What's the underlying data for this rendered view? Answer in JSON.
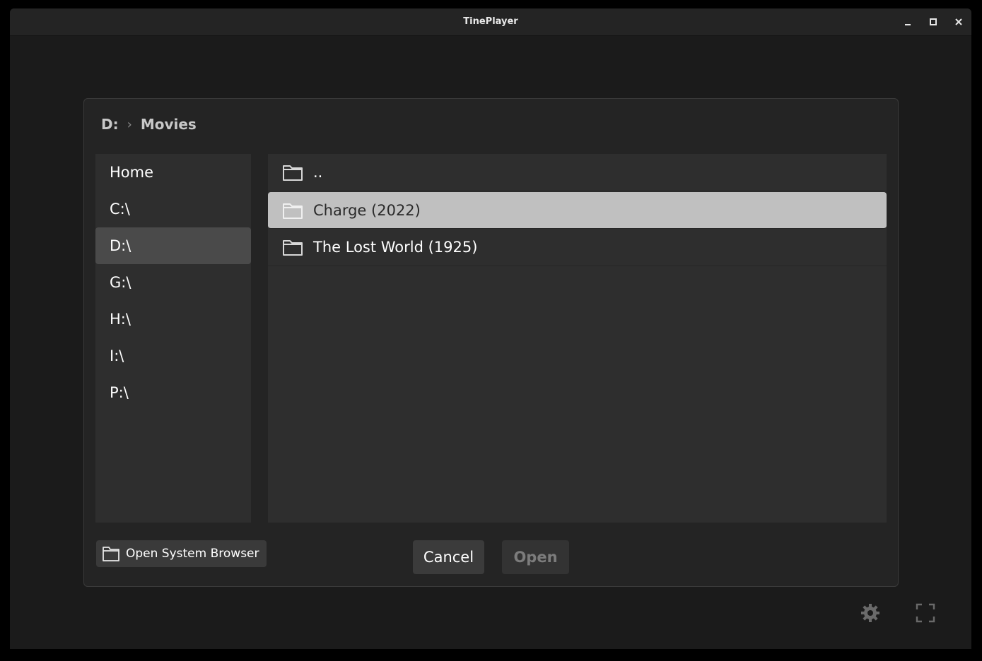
{
  "window": {
    "title": "TinePlayer",
    "controls": [
      "minimize-icon",
      "maximize-icon",
      "close-icon"
    ]
  },
  "dialog": {
    "breadcrumb": [
      "D:",
      "Movies"
    ],
    "breadcrumb_separator": "›",
    "sidebar": {
      "items": [
        {
          "label": "Home",
          "active": false
        },
        {
          "label": "C:\\",
          "active": false
        },
        {
          "label": "D:\\",
          "active": true
        },
        {
          "label": "G:\\",
          "active": false
        },
        {
          "label": "H:\\",
          "active": false
        },
        {
          "label": "I:\\",
          "active": false
        },
        {
          "label": "P:\\",
          "active": false
        }
      ]
    },
    "files": [
      {
        "name": "..",
        "icon": "folder-icon",
        "selected": false
      },
      {
        "name": "Charge (2022)",
        "icon": "folder-icon",
        "selected": true
      },
      {
        "name": "The Lost World (1925)",
        "icon": "folder-icon",
        "selected": false
      }
    ],
    "system_browser_label": "Open System Browser",
    "cancel_label": "Cancel",
    "open_label": "Open"
  },
  "bottom_controls": [
    "gear-icon",
    "fullscreen-icon"
  ],
  "colors": {
    "background": "#1b1b1b",
    "dialog": "#242424",
    "panel": "#2e2e2e",
    "selected_row": "#c0c0c0",
    "active_sidebar": "#4a4a4a"
  }
}
